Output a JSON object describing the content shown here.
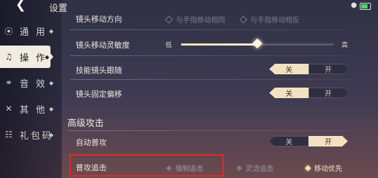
{
  "header": {
    "title": "设置",
    "back_icon": "chevron-left-icon"
  },
  "sidebar": {
    "items": [
      {
        "label": "通 用",
        "icon": "signal-icon",
        "active": false
      },
      {
        "label": "操 作",
        "icon": "guitar-icon",
        "active": true
      },
      {
        "label": "音 效",
        "icon": "headphones-icon",
        "active": false
      },
      {
        "label": "其 他",
        "icon": "tools-icon",
        "active": false
      },
      {
        "label": "礼包码",
        "icon": "gift-icon",
        "active": false
      }
    ]
  },
  "camera_direction": {
    "label": "镜头移动方向",
    "options": [
      "与手指移动相同",
      "与手指移动相反"
    ]
  },
  "camera_sensitivity": {
    "label": "镜头移动灵敏度",
    "low": "低",
    "high": "高",
    "value_fraction": 0.5
  },
  "skill_camera_follow": {
    "label": "技能镜头跟随",
    "off": "关",
    "on": "开",
    "selected": "关"
  },
  "camera_fixed_offset": {
    "label": "镜头固定偏移",
    "off": "关",
    "on": "开",
    "selected": "关"
  },
  "advanced_attack": {
    "title": "高级攻击",
    "auto_attack": {
      "label": "自动普攻",
      "off": "关",
      "on": "开",
      "selected": "开"
    },
    "basic_attack_chase": {
      "label": "普攻追击",
      "options": [
        "强制追击",
        "灵活追击",
        "移动优先"
      ],
      "selected": "移动优先"
    }
  },
  "colors": {
    "accent": "#f2e2c2",
    "highlight_border": "#e02b2b"
  }
}
